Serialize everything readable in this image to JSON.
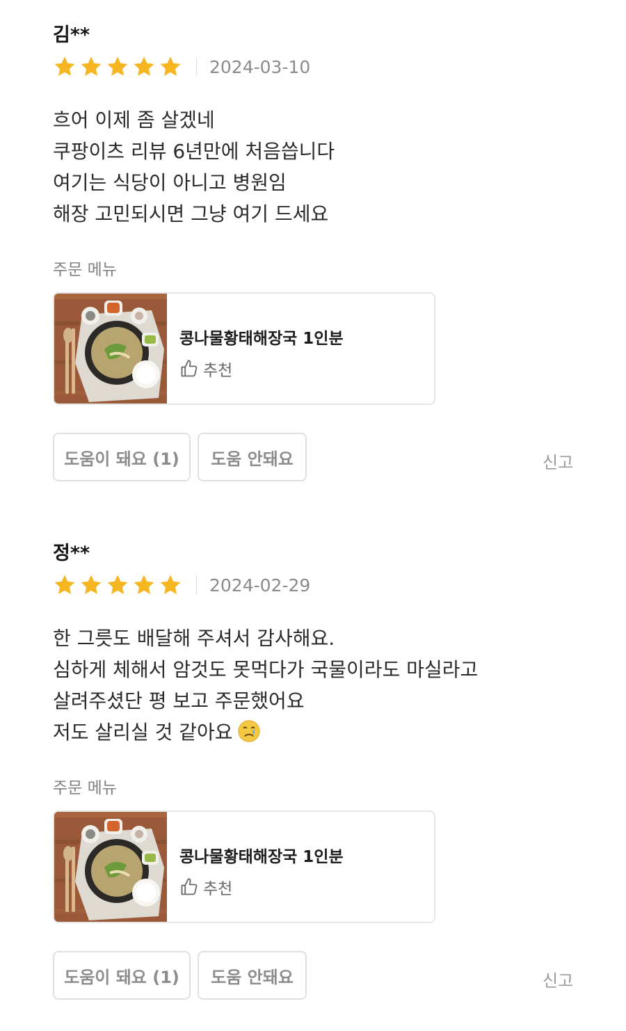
{
  "reviews": [
    {
      "author": "김**",
      "rating": 5,
      "date": "2024-03-10",
      "body": [
        "흐어 이제 좀 살겠네",
        "쿠팡이츠 리뷰 6년만에 처음씁니다",
        "여기는 식당이 아니고 병원임",
        "해장 고민되시면 그냥 여기 드세요"
      ],
      "menu_label": "주문 메뉴",
      "menu_item": "콩나물황태해장국 1인분",
      "recommend_label": "추천",
      "helpful_label": "도움이 돼요 (1)",
      "not_helpful_label": "도움 안돼요",
      "report_label": "신고"
    },
    {
      "author": "정**",
      "rating": 5,
      "date": "2024-02-29",
      "body": [
        "한 그릇도 배달해 주셔서 감사해요.",
        "심하게 체해서 암것도 못먹다가 국물이라도 마실라고",
        "살려주셨단 평 보고 주문했어요",
        "저도 살리실 것  같아요"
      ],
      "body_emoji": "crying-face-emoji",
      "menu_label": "주문 메뉴",
      "menu_item": "콩나물황태해장국 1인분",
      "recommend_label": "추천",
      "helpful_label": "도움이 돼요 (1)",
      "not_helpful_label": "도움 안돼요",
      "report_label": "신고"
    }
  ],
  "colors": {
    "star": "#f6b621",
    "text": "#2a2a2a",
    "muted": "#8a8a8a",
    "border": "#e0e0e0"
  }
}
